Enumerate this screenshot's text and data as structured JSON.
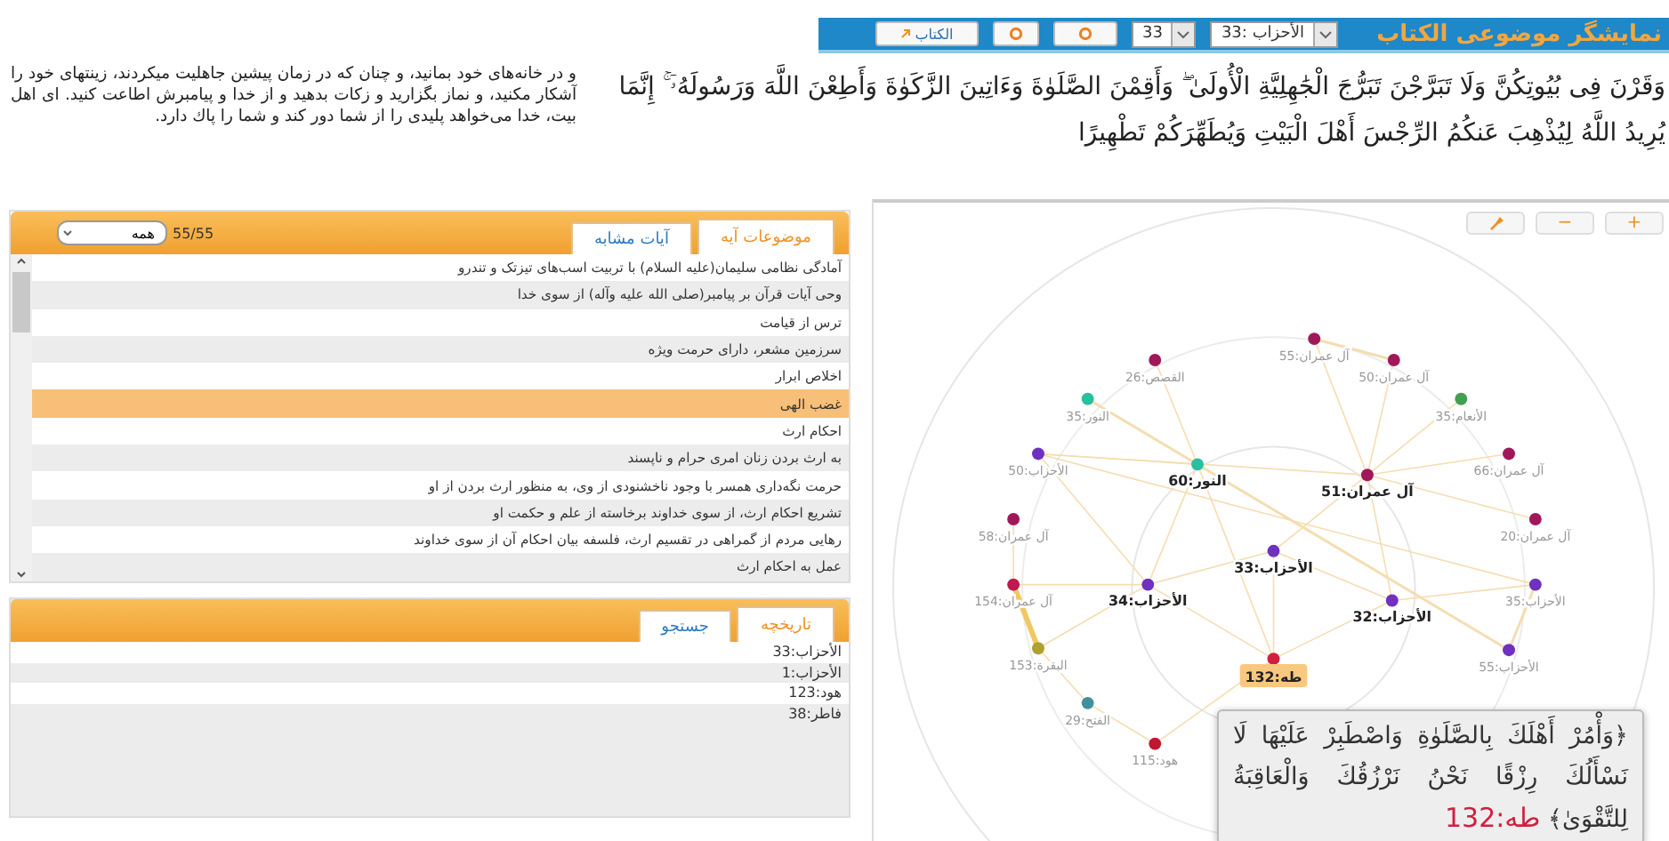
{
  "header": {
    "title": "نمایشگر موضوعی الکتاب",
    "surah_select": {
      "value": "33: الأحزاب"
    },
    "verse_select": {
      "value": "33"
    },
    "book_button": {
      "label": "الکتاب"
    }
  },
  "verse": {
    "arabic": "وَقَرْنَ فِى بُيُوتِكُنَّ وَلَا تَبَرَّجْنَ تَبَرُّجَ الْجَٰهِلِيَّةِ الْأُولَىٰ ۖ وَأَقِمْنَ الصَّلَوٰةَ وَءَاتِينَ الزَّكَوٰةَ وَأَطِعْنَ اللَّهَ وَرَسُولَهُۥٓ ۚ إِنَّمَا يُرِيدُ اللَّهُ لِيُذْهِبَ عَنكُمُ الرِّجْسَ أَهْلَ الْبَيْتِ وَيُطَهِّرَكُمْ تَطْهِيرًا",
    "translation": "و در خانه‌هاى خود بمانيد، و چنان كه در زمان پيشين جاهليت ميكردند، زينتهاى خود را آشكار مكنيد، و نماز بگزاريد و زكات بدهيد و از خدا و پيامبرش اطاعت كنيد. اى اهل بيت، خدا مى‌خواهد پليدى را از شما دور كند و شما را پاك دارد."
  },
  "topics_panel": {
    "tabs": [
      {
        "label": "موضوعات آیه",
        "selected": true
      },
      {
        "label": "آیات مشابه",
        "selected": false
      }
    ],
    "count": "55/55",
    "filter": {
      "value": "همه"
    },
    "items": [
      {
        "label": "آمادگی نظامی سلیمان(علیه السلام) با تربیت اسب‌های تیزتک و تندرو",
        "selected": false
      },
      {
        "label": "وحی آیات قرآن بر پیامبر(صلی الله علیه وآله) از سوی خدا",
        "selected": false
      },
      {
        "label": "ترس از قیامت",
        "selected": false
      },
      {
        "label": "سرزمین مشعر، دارای حرمت ویژه",
        "selected": false
      },
      {
        "label": "اخلاص ابرار",
        "selected": false
      },
      {
        "label": "غضب الهی",
        "selected": true
      },
      {
        "label": "احکام ارث",
        "selected": false
      },
      {
        "label": "به ارث بردن زنان امری حرام و ناپسند",
        "selected": false
      },
      {
        "label": "حرمت نگه‌داری همسر با وجود ناخشنودی از وی، به منظور ارث بردن از او",
        "selected": false
      },
      {
        "label": "تشریع احکام ارث، از سوی خداوند برخاسته از علم و حکمت او",
        "selected": false
      },
      {
        "label": "رهایی مردم از گمراهی در تقسیم ارث، فلسفه بیان احکام آن از سوی خداوند",
        "selected": false
      },
      {
        "label": "عمل به احکام ارث",
        "selected": false
      }
    ]
  },
  "history_panel": {
    "tabs": [
      {
        "label": "تاریخچه",
        "selected": true
      },
      {
        "label": "جستجو",
        "selected": false
      }
    ],
    "items": [
      "الأحزاب:33",
      "الأحزاب:1",
      "هود:123",
      "فاطر:38"
    ]
  },
  "graph": {
    "controls": [
      "+",
      "−"
    ],
    "nodes": [
      {
        "label": "آل عمران:55",
        "color": "#a0185a",
        "kind": "secondary",
        "selected": false
      },
      {
        "label": "آل عمران:50",
        "color": "#a0185a",
        "kind": "secondary",
        "selected": false
      },
      {
        "label": "القصص:26",
        "color": "#a0185a",
        "kind": "secondary",
        "selected": false
      },
      {
        "label": "الأنعام:35",
        "color": "#40a050",
        "kind": "secondary",
        "selected": false
      },
      {
        "label": "النور:35",
        "color": "#28c0a0",
        "kind": "secondary",
        "selected": false
      },
      {
        "label": "آل عمران:66",
        "color": "#a0185a",
        "kind": "secondary",
        "selected": false
      },
      {
        "label": "آل عمران:51",
        "color": "#a0185a",
        "kind": "primary",
        "selected": false
      },
      {
        "label": "النور:60",
        "color": "#28c0a0",
        "kind": "primary",
        "selected": false
      },
      {
        "label": "الأحزاب:50",
        "color": "#7030c0",
        "kind": "secondary",
        "selected": false
      },
      {
        "label": "آل عمران:20",
        "color": "#a0185a",
        "kind": "secondary",
        "selected": false
      },
      {
        "label": "آل عمران:58",
        "color": "#a0185a",
        "kind": "secondary",
        "selected": false
      },
      {
        "label": "الأحزاب:33",
        "color": "#7030c0",
        "kind": "primary",
        "selected": false
      },
      {
        "label": "الأحزاب:35",
        "color": "#7030c0",
        "kind": "secondary",
        "selected": false
      },
      {
        "label": "الأحزاب:32",
        "color": "#7030c0",
        "kind": "primary",
        "selected": false
      },
      {
        "label": "الأحزاب:34",
        "color": "#7030c0",
        "kind": "primary",
        "selected": false
      },
      {
        "label": "آل عمران:154",
        "color": "#c01850",
        "kind": "secondary",
        "selected": false
      },
      {
        "label": "الأحزاب:55",
        "color": "#7030c0",
        "kind": "secondary",
        "selected": false
      },
      {
        "label": "طه:132",
        "color": "#d02040",
        "kind": "primary",
        "selected": true
      },
      {
        "label": "البقرة:153",
        "color": "#b0a030",
        "kind": "secondary",
        "selected": false
      },
      {
        "label": "الفتح:29",
        "color": "#4090a0",
        "kind": "secondary",
        "selected": false
      },
      {
        "label": "هود:115",
        "color": "#c01830",
        "kind": "secondary",
        "selected": false
      }
    ],
    "popup": {
      "verse": "﴿وَأْمُرْ أَهْلَكَ بِالصَّلَوٰةِ وَاصْطَبِرْ عَلَيْهَا لَا نَسْأَلُكَ رِزْقًا نَحْنُ نَرْزُقُكَ وَالْعَاقِبَةُ لِلتَّقْوَىٰ﴾",
      "reference": "طه:132"
    }
  }
}
